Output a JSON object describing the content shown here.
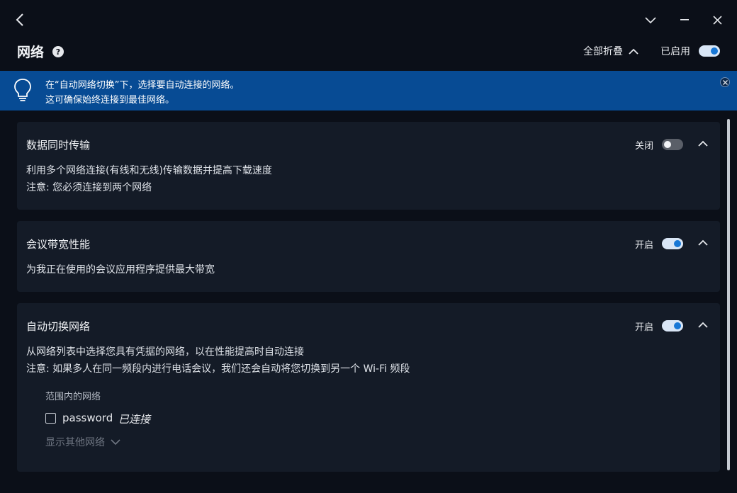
{
  "header": {
    "title": "网络",
    "help_icon": "question-icon",
    "collapse_all_label": "全部折叠",
    "enabled_label": "已启用",
    "enabled": true
  },
  "window_controls": [
    "back-icon",
    "chevron-down-icon",
    "minimize-icon",
    "close-icon"
  ],
  "banner": {
    "line1": "在“自动网络切换”下，选择要自动连接的网络。",
    "line2": "这可确保始终连接到最佳网络。",
    "icon": "lightbulb-icon",
    "background": "#074b94"
  },
  "cards": [
    {
      "title": "数据同时传输",
      "state_label": "关闭",
      "enabled": false,
      "description": [
        "利用多个网络连接(有线和无线)传输数据并提高下载速度",
        "注意: 您必须连接到两个网络"
      ]
    },
    {
      "title": "会议带宽性能",
      "state_label": "开启",
      "enabled": true,
      "description": [
        "为我正在使用的会议应用程序提供最大带宽"
      ]
    },
    {
      "title": "自动切换网络",
      "state_label": "开启",
      "enabled": true,
      "description": [
        "从网络列表中选择您具有凭据的网络，以在性能提高时自动连接",
        "注意: 如果多人在同一频段内进行电话会议，我们还会自动将您切换到另一个 Wi-Fi 频段"
      ],
      "networks_heading": "范围内的网络",
      "networks": [
        {
          "name": "password",
          "status": "已连接",
          "checked": false
        }
      ],
      "show_others_label": "显示其他网络"
    }
  ],
  "colors": {
    "background": "#0b0f18",
    "card": "#141b27",
    "accent": "#1777d6"
  }
}
